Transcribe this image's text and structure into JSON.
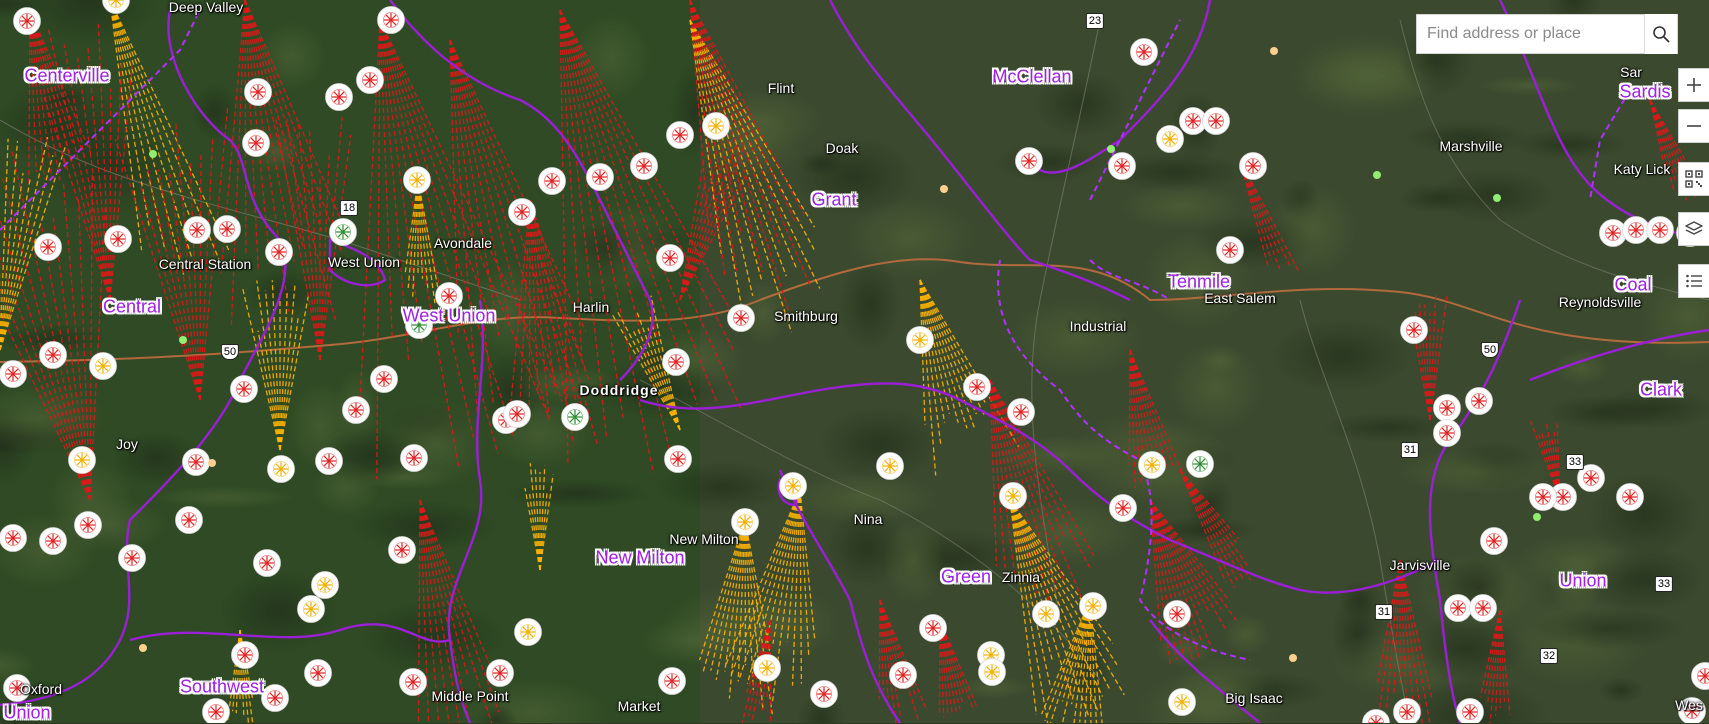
{
  "search": {
    "placeholder": "Find address or place"
  },
  "controls": {
    "zoom_in": "zoom-in-icon",
    "zoom_out": "zoom-out-icon",
    "qr": "qr-code-icon",
    "layers": "layers-icon",
    "legend": "legend-list-icon"
  },
  "colors": {
    "district_boundary": "#9b1fd6",
    "major_road": "#b06a3c",
    "red_sightline": "#e01818",
    "yellow_sightline": "#ffb400",
    "label_text": "#ffffff",
    "district_text": "#a020e6"
  },
  "places": [
    "Deep Valley",
    "Flint",
    "Doak",
    "Marshville",
    "Katy Lick",
    "Central Station",
    "West Union",
    "Avondale",
    "Harlin",
    "Smithburg",
    "Doddridge",
    "Industrial",
    "East Salem",
    "Reynoldsville",
    "Joy",
    "New Milton",
    "Nina",
    "Zinnia",
    "Jarvisville",
    "Oxford",
    "Middle Point",
    "Market",
    "Big Isaac",
    "Sar",
    "Wes"
  ],
  "districts": [
    "Centerville",
    "McClellan",
    "Sardis",
    "Grant",
    "Central",
    "West Union",
    "Tenmile",
    "Coal",
    "Clark",
    "New Milton",
    "Green",
    "Union",
    "Southwest",
    "Union"
  ],
  "route_shields": [
    "23",
    "18",
    "50",
    "50",
    "31",
    "33",
    "31",
    "33",
    "32"
  ]
}
